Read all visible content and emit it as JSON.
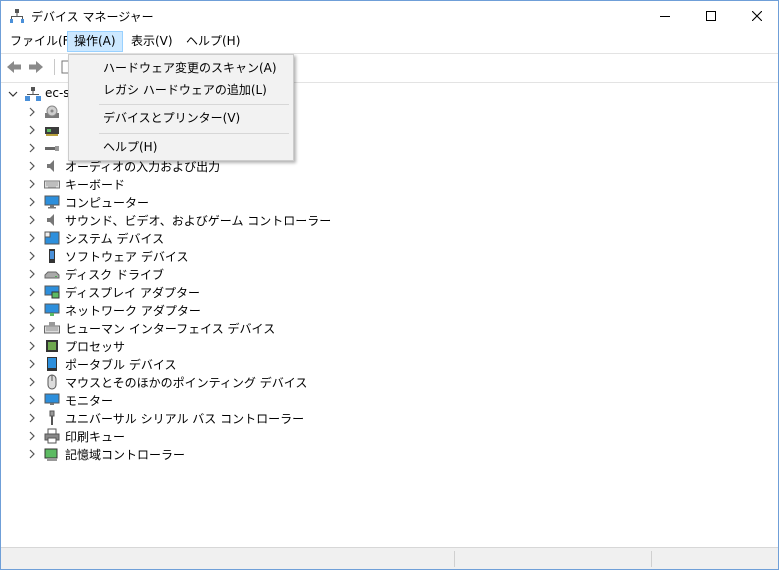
{
  "window": {
    "title": "デバイス マネージャー"
  },
  "menubar": {
    "items": [
      {
        "label": "ファイル(F)"
      },
      {
        "label": "操作(A)"
      },
      {
        "label": "表示(V)"
      },
      {
        "label": "ヘルプ(H)"
      }
    ]
  },
  "action_menu": {
    "items": [
      {
        "label": "ハードウェア変更のスキャン(A)"
      },
      {
        "label": "レガシ ハードウェアの追加(L)"
      },
      {
        "label": "デバイスとプリンター(V)"
      },
      {
        "label": "ヘルプ(H)"
      }
    ]
  },
  "tree": {
    "root": {
      "label": "ec-s"
    },
    "categories": [
      {
        "label": "",
        "icon": "dvd-drive-icon"
      },
      {
        "label": "",
        "icon": "storage-controller-icon"
      },
      {
        "label": "",
        "icon": "usb-device-icon"
      },
      {
        "label": "オーディオの入力および出力",
        "icon": "speaker-icon"
      },
      {
        "label": "キーボード",
        "icon": "keyboard-icon"
      },
      {
        "label": "コンピューター",
        "icon": "computer-icon"
      },
      {
        "label": "サウンド、ビデオ、およびゲーム コントローラー",
        "icon": "speaker-icon"
      },
      {
        "label": "システム デバイス",
        "icon": "system-devices-icon"
      },
      {
        "label": "ソフトウェア デバイス",
        "icon": "software-device-icon"
      },
      {
        "label": "ディスク ドライブ",
        "icon": "disk-drive-icon"
      },
      {
        "label": "ディスプレイ アダプター",
        "icon": "display-adapter-icon"
      },
      {
        "label": "ネットワーク アダプター",
        "icon": "network-adapter-icon"
      },
      {
        "label": "ヒューマン インターフェイス デバイス",
        "icon": "hid-icon"
      },
      {
        "label": "プロセッサ",
        "icon": "processor-icon"
      },
      {
        "label": "ポータブル デバイス",
        "icon": "portable-device-icon"
      },
      {
        "label": "マウスとそのほかのポインティング デバイス",
        "icon": "mouse-icon"
      },
      {
        "label": "モニター",
        "icon": "monitor-icon"
      },
      {
        "label": "ユニバーサル シリアル バス コントローラー",
        "icon": "usb-icon"
      },
      {
        "label": "印刷キュー",
        "icon": "printer-icon"
      },
      {
        "label": "記憶域コントローラー",
        "icon": "storage-controller-icon"
      }
    ]
  }
}
